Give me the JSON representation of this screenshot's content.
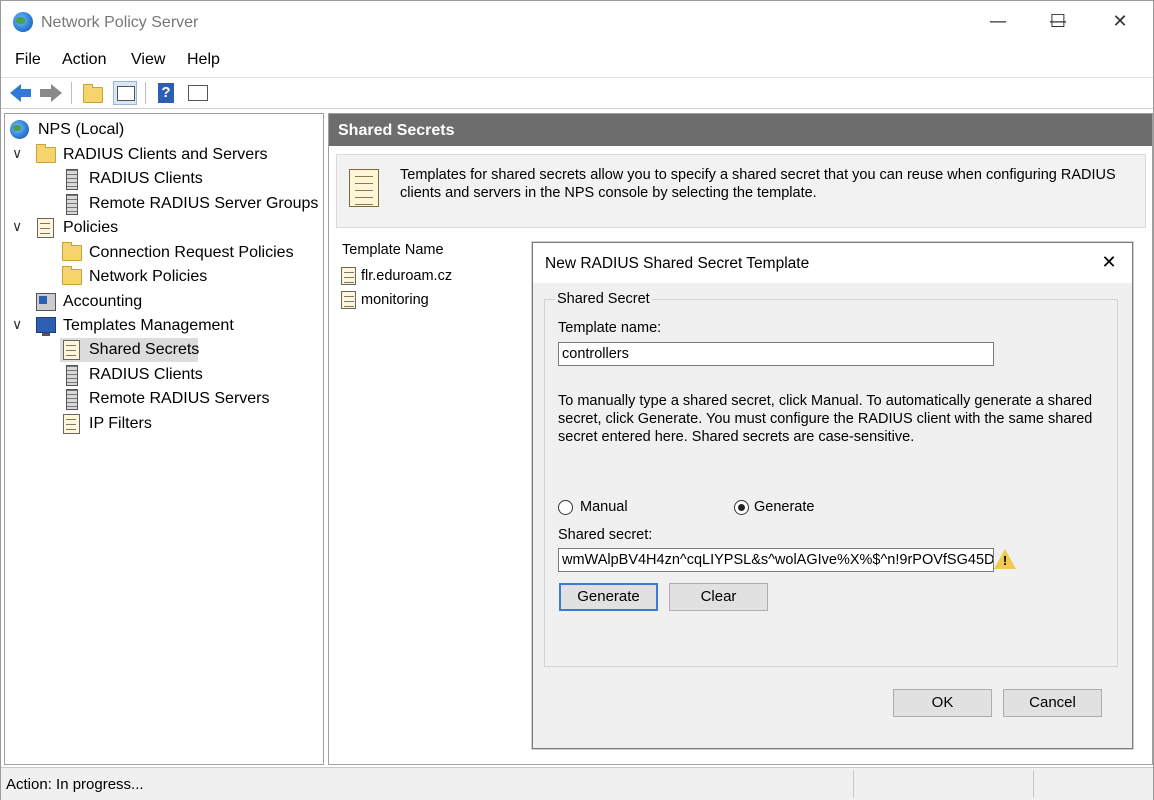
{
  "window": {
    "title": "Network Policy Server"
  },
  "menu": [
    "File",
    "Action",
    "View",
    "Help"
  ],
  "toolbar": {
    "icons": [
      "back-arrow-icon",
      "forward-arrow-icon",
      "up-folder-icon",
      "show-hide-tree-icon",
      "help-icon",
      "show-hide-action-pane-icon"
    ]
  },
  "tree": {
    "root": "NPS (Local)",
    "radius_group": "RADIUS Clients and Servers",
    "radius_clients": "RADIUS Clients",
    "remote_radius_server_groups": "Remote RADIUS Server Groups",
    "policies": "Policies",
    "connection_request_policies": "Connection Request Policies",
    "network_policies": "Network Policies",
    "accounting": "Accounting",
    "templates_management": "Templates Management",
    "shared_secrets": "Shared Secrets",
    "tm_radius_clients": "RADIUS Clients",
    "remote_radius_servers": "Remote RADIUS Servers",
    "ip_filters": "IP Filters"
  },
  "main": {
    "header": "Shared Secrets",
    "info": "Templates for shared secrets allow you to specify a shared secret that you can reuse when configuring RADIUS clients and servers in the NPS console by selecting the template.",
    "column_header": "Template Name",
    "items": [
      "flr.eduroam.cz",
      "monitoring"
    ]
  },
  "dialog": {
    "title": "New RADIUS Shared Secret Template",
    "group_label": "Shared Secret",
    "template_name_label": "Template name:",
    "template_name_value": "controllers",
    "instructions": "To manually type a shared secret, click Manual. To automatically generate a shared secret, click Generate. You must configure the RADIUS client with the same shared secret entered here. Shared secrets are case-sensitive.",
    "radio_manual": "Manual",
    "radio_generate": "Generate",
    "selected_option": "Generate",
    "shared_secret_label": "Shared secret:",
    "shared_secret_value": "wmWAlpBV4H4zn^cqLIYPSL&s^wolAGIve%X%$^n!9rPOVfSG45D",
    "generate_button": "Generate",
    "clear_button": "Clear",
    "ok_button": "OK",
    "cancel_button": "Cancel"
  },
  "status": {
    "text": "Action:  In progress..."
  },
  "colors": {
    "pane_header": "#6d6d6d",
    "accent": "#3a7bd5",
    "warning": "#f2c94c"
  }
}
